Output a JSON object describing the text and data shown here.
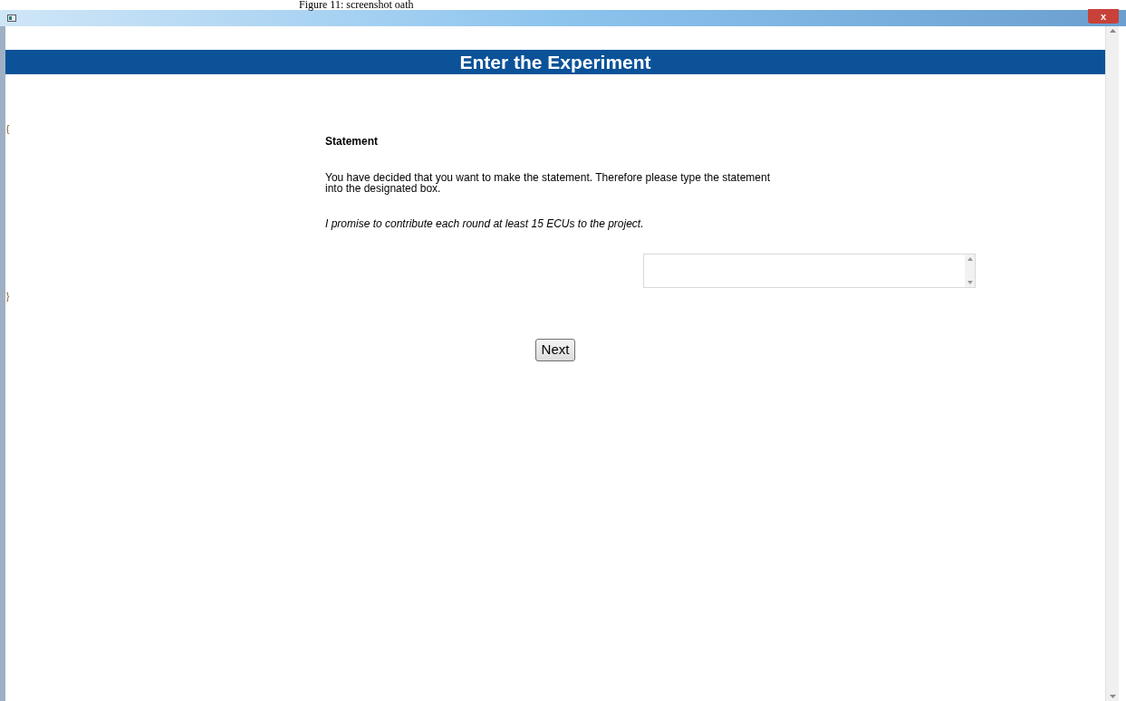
{
  "caption": "Figure 11: screenshot oath",
  "window": {
    "close": "x"
  },
  "banner": "Enter the Experiment",
  "left_marks": [
    "{",
    "}"
  ],
  "heading": "Statement",
  "instruction": "You have decided that you want to make the statement. Therefore please type the statement into the designated box.",
  "statement": "I promise to contribute each round at least 15 ECUs to the project.",
  "next_button": "Next"
}
